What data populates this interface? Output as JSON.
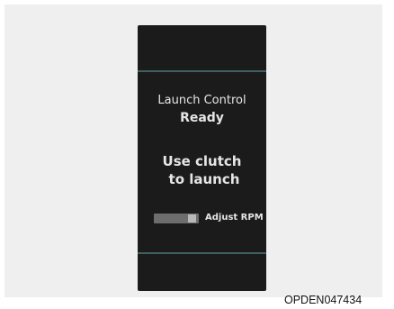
{
  "display": {
    "title": "Launch Control",
    "status": "Ready",
    "instruction_line1": "Use clutch",
    "instruction_line2": "to launch",
    "rpm_label": "Adjust RPM"
  },
  "icons": {
    "rpm_control": "adjust-rpm-switch-icon"
  },
  "colors": {
    "screen_background": "#1b1b1b",
    "divider": "#3f5f60",
    "text": "#e6e6e6",
    "frame_background": "#efefef"
  },
  "image_code": "OPDEN047434"
}
